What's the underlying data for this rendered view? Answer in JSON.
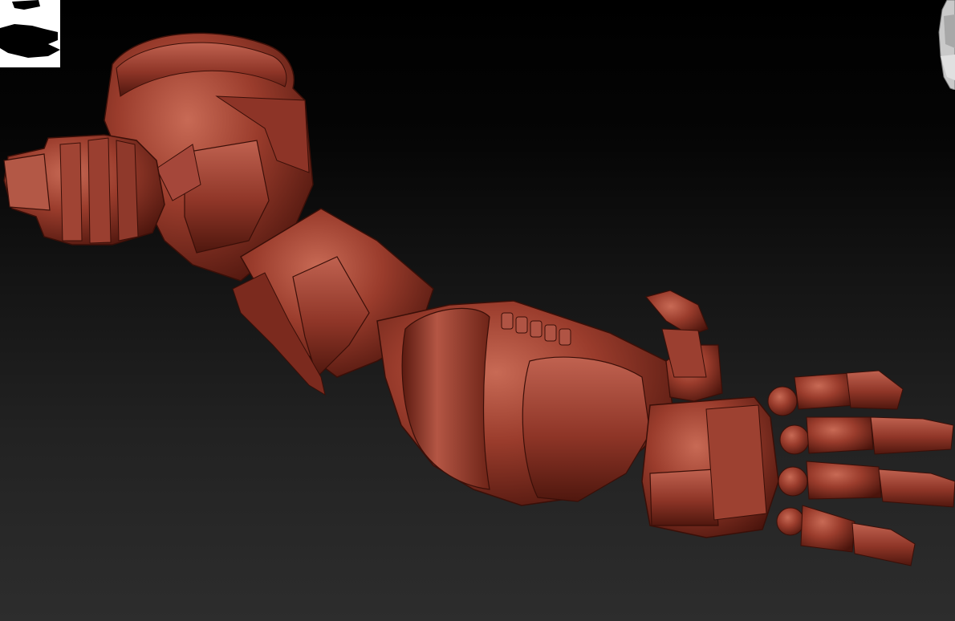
{
  "app": {
    "name": "",
    "view": "3d-viewport"
  },
  "viewport": {
    "background_top": "#000000",
    "background_bottom": "#2d2d2d",
    "model": {
      "name": "",
      "material_color": "#9a3c2c",
      "highlight_color": "#c86a55",
      "shadow_color": "#4a140c"
    }
  },
  "navigator": {
    "background": "#ffffff",
    "silhouette_color": "#000000"
  },
  "navcube": {
    "icon": "head-navigation-cube"
  }
}
